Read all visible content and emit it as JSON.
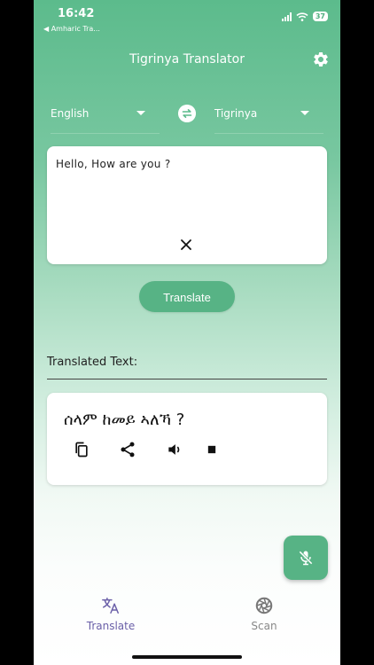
{
  "status_bar": {
    "time": "16:42",
    "back_label": "◀ Amharic Tra...",
    "battery": "37"
  },
  "header": {
    "title": "Tigrinya Translator"
  },
  "languages": {
    "source": "English",
    "target": "Tigrinya"
  },
  "input": {
    "text": "Hello, How are you ?"
  },
  "actions": {
    "translate_label": "Translate"
  },
  "output": {
    "section_label": "Translated Text:",
    "text": "ሰላም ከመይ ኣለኻ ?"
  },
  "bottom_nav": {
    "items": [
      {
        "label": "Translate"
      },
      {
        "label": "Scan"
      }
    ]
  },
  "colors": {
    "accent": "#57b385",
    "nav_active": "#6a5fa8",
    "nav_inactive": "#888888"
  }
}
